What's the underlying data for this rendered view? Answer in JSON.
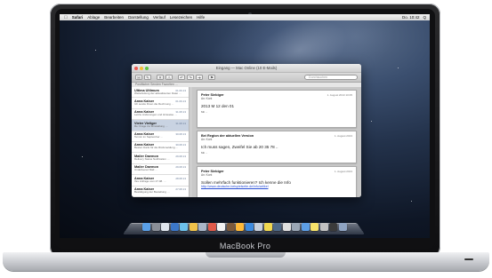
{
  "device": {
    "brand_label": "MacBook Pro"
  },
  "menubar": {
    "app_name": "Safari",
    "items": [
      "Ablage",
      "Bearbeiten",
      "Darstellung",
      "Verlauf",
      "Lesezeichen",
      "Hilfe"
    ],
    "status": [
      "Do. 10:42",
      "Q"
    ]
  },
  "mail": {
    "window_title": "Eingang — Mac Online (10 E-Mails)",
    "search_placeholder": "Durchsuchen",
    "favorites": "Postfächer   Senden   Favoriten   ...",
    "messages": [
      {
        "from": "Ultima Ultimum",
        "date": "01.09.13",
        "preview": "Weiterleitung der aktualisierten Datei …"
      },
      {
        "from": "Anna Kaiser",
        "date": "01.09.13",
        "preview": "Ich sende Ihnen die Rechnung …"
      },
      {
        "from": "Anna Kaiser",
        "date": "31.08.13",
        "preview": "Letzte Änderungen und Hinweise …"
      },
      {
        "from": "Vieler Vieliger",
        "date": "31.08.13",
        "preview": "Re: Frage zur Einstellung …"
      },
      {
        "from": "Anna Kaiser",
        "date": "30.08.13",
        "preview": "Termin im September …"
      },
      {
        "from": "Anna Kaiser",
        "date": "30.08.13",
        "preview": "Besten Dank für die Rückmeldung …"
      },
      {
        "from": "Mailer Daemon",
        "date": "29.08.13",
        "preview": "Delivery Status Notification …"
      },
      {
        "from": "Mailer Daemon",
        "date": "29.08.13",
        "preview": "Undelivered Mail …"
      },
      {
        "from": "Anna Kaiser",
        "date": "28.08.13",
        "preview": "Ihre Anfrage vom 27.08. …"
      },
      {
        "from": "Anna Kaiser",
        "date": "27.08.13",
        "preview": "Bestätigung der Bestellung …"
      }
    ],
    "cards": [
      {
        "from": "Peter Siebiger",
        "date": "1. August 2013 10:05",
        "line1": "An: Kont",
        "body": "2013 M 12 den 01",
        "small": "Mit ... "
      },
      {
        "from": "Bei Region der aktuellen Version",
        "date": "1. August 2013",
        "line1": "An: Kont",
        "body": "Ich muss sagen, Zweifel Sie ab 20 35 78 ..",
        "small": "Mit ..."
      },
      {
        "from": "Peter Siebiger",
        "date": "1. August 2013",
        "line1": "An: Kont",
        "body": "Sollen mehrfach funktionieren? Ich kenne die Info",
        "link": "http://www.deutsche-beispielseite.de/info/artikel",
        "small": ""
      }
    ]
  },
  "dock": {
    "icon_colors": [
      "#5aa0e8",
      "#8a8f98",
      "#e0e6ee",
      "#3c77c8",
      "#6cc0ea",
      "#f0c24a",
      "#a9b6c8",
      "#e05a4a",
      "#f2f2f2",
      "#7d5a3c",
      "#ffb938",
      "#3d8be0",
      "#c7d0dd",
      "#f0d850",
      "#4f6b8a",
      "#e0e0e0",
      "#9aa6b5",
      "#5d9ee6",
      "#f7e36a",
      "#c2c2c2",
      "#3b3b3b",
      "#8ea3c2"
    ]
  }
}
